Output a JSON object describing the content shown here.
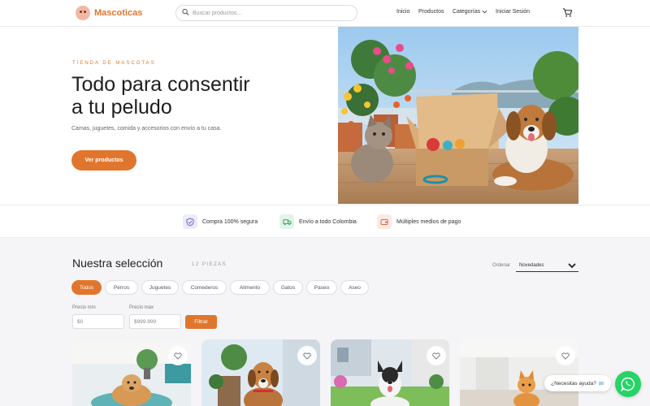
{
  "header": {
    "brand": "Mascoticas",
    "search_placeholder": "Buscar productos...",
    "nav": [
      "Inicio",
      "Productos",
      "Categorías",
      "Iniciar Sesión"
    ]
  },
  "hero": {
    "eyebrow": "TIENDA DE MASCOTAS",
    "title_line1": "Todo para consentir",
    "title_line2": "a tu peludo",
    "subtitle": "Camas, juguetes, comida y accesorios con envío a tu casa.",
    "cta": "Ver productos"
  },
  "benefits": [
    {
      "label": "Compra 100% segura",
      "icon": "shield-icon"
    },
    {
      "label": "Envío a todo Colombia",
      "icon": "truck-icon"
    },
    {
      "label": "Múltiples medios de pago",
      "icon": "wallet-icon"
    }
  ],
  "selection": {
    "title": "Nuestra selección",
    "count": "12 PIEZAS",
    "order_label": "Ordenar",
    "order_value": "Novedades",
    "chips": [
      "Todos",
      "Perros",
      "Juguetes",
      "Comederos",
      "Alimento",
      "Gatos",
      "Paseo",
      "Aseo"
    ],
    "active_chip": "Todos",
    "price_min_label": "Precio mín",
    "price_max_label": "Precio máx",
    "price_min_value": "$0",
    "price_max_value": "$999.999",
    "filter_label": "Filtrar"
  },
  "help": {
    "text": "¿Necesitas ayuda?"
  },
  "colors": {
    "accent": "#e0762e",
    "whatsapp": "#25d366"
  }
}
